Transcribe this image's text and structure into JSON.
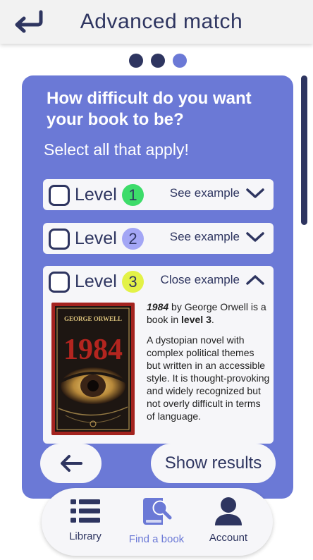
{
  "header": {
    "title": "Advanced match",
    "back_icon": "return-arrow-icon"
  },
  "progress": {
    "steps": 3,
    "current": 3
  },
  "question": {
    "title": "How difficult do you want your book to be?",
    "subtitle": "Select all that apply!"
  },
  "levels": [
    {
      "label": "Level",
      "number": "1",
      "badge_color": "#3ddc6a",
      "toggle": "See example",
      "expanded": false
    },
    {
      "label": "Level",
      "number": "2",
      "badge_color": "#a3a6f5",
      "toggle": "See example",
      "expanded": false
    },
    {
      "label": "Level",
      "number": "3",
      "badge_color": "#e3f247",
      "toggle": "Close example",
      "expanded": true
    }
  ],
  "example": {
    "cover_author": "GEORGE ORWELL",
    "cover_title": "1984",
    "book_title": "1984",
    "by_text": " by George Orwell is a book in ",
    "level_text": "level 3",
    "period": ".",
    "description": "A dystopian novel with complex political themes but written in an accessible style. It is thought-provoking and widely recognized but not overly difficult in terms of language."
  },
  "buttons": {
    "back_icon": "arrow-left-icon",
    "show_results": "Show results"
  },
  "nav": [
    {
      "label": "Library",
      "icon": "list-icon",
      "active": false
    },
    {
      "label": "Find a book",
      "icon": "book-search-icon",
      "active": true
    },
    {
      "label": "Account",
      "icon": "user-icon",
      "active": false
    }
  ],
  "colors": {
    "primary": "#6b79d6",
    "dark": "#2e3560",
    "surface": "#f6f6f9"
  }
}
